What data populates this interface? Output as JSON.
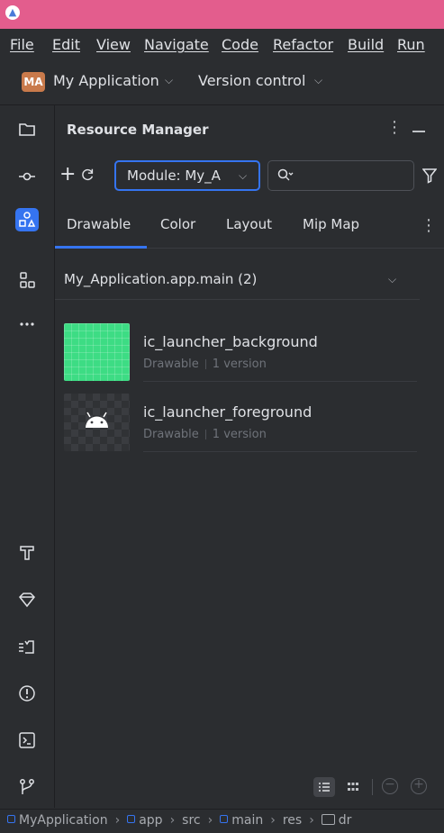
{
  "app": {
    "logo_icon": "android-studio-logo-icon"
  },
  "menu": [
    "File",
    "Edit",
    "View",
    "Navigate",
    "Code",
    "Refactor",
    "Build",
    "Run"
  ],
  "project": {
    "badge": "MA",
    "name": "My Application",
    "version_control": "Version control"
  },
  "left_toolbar": [
    "folder-icon",
    "commit-icon",
    "resource-manager-icon",
    "structure-icon",
    "more-icon",
    "build-hammer-icon",
    "gem-icon",
    "logcat-icon",
    "problems-icon",
    "terminal-icon",
    "git-icon"
  ],
  "panel": {
    "title": "Resource Manager",
    "module_select": "Module: My_A",
    "search_placeholder": "",
    "tabs": [
      "Drawable",
      "Color",
      "Layout",
      "Mip Map"
    ],
    "active_tab": "Drawable",
    "group": "My_Application.app.main (2)",
    "resources": [
      {
        "name": "ic_launcher_background",
        "type": "Drawable",
        "versions": "1 version"
      },
      {
        "name": "ic_launcher_foreground",
        "type": "Drawable",
        "versions": "1 version"
      }
    ]
  },
  "breadcrumb": [
    "MyApplication",
    "app",
    "src",
    "main",
    "res",
    "dr"
  ],
  "colors": {
    "title_bar": "#e35d8d",
    "accent": "#3574f0",
    "background": "#2b2d30",
    "android_green": "#3ddc84"
  }
}
